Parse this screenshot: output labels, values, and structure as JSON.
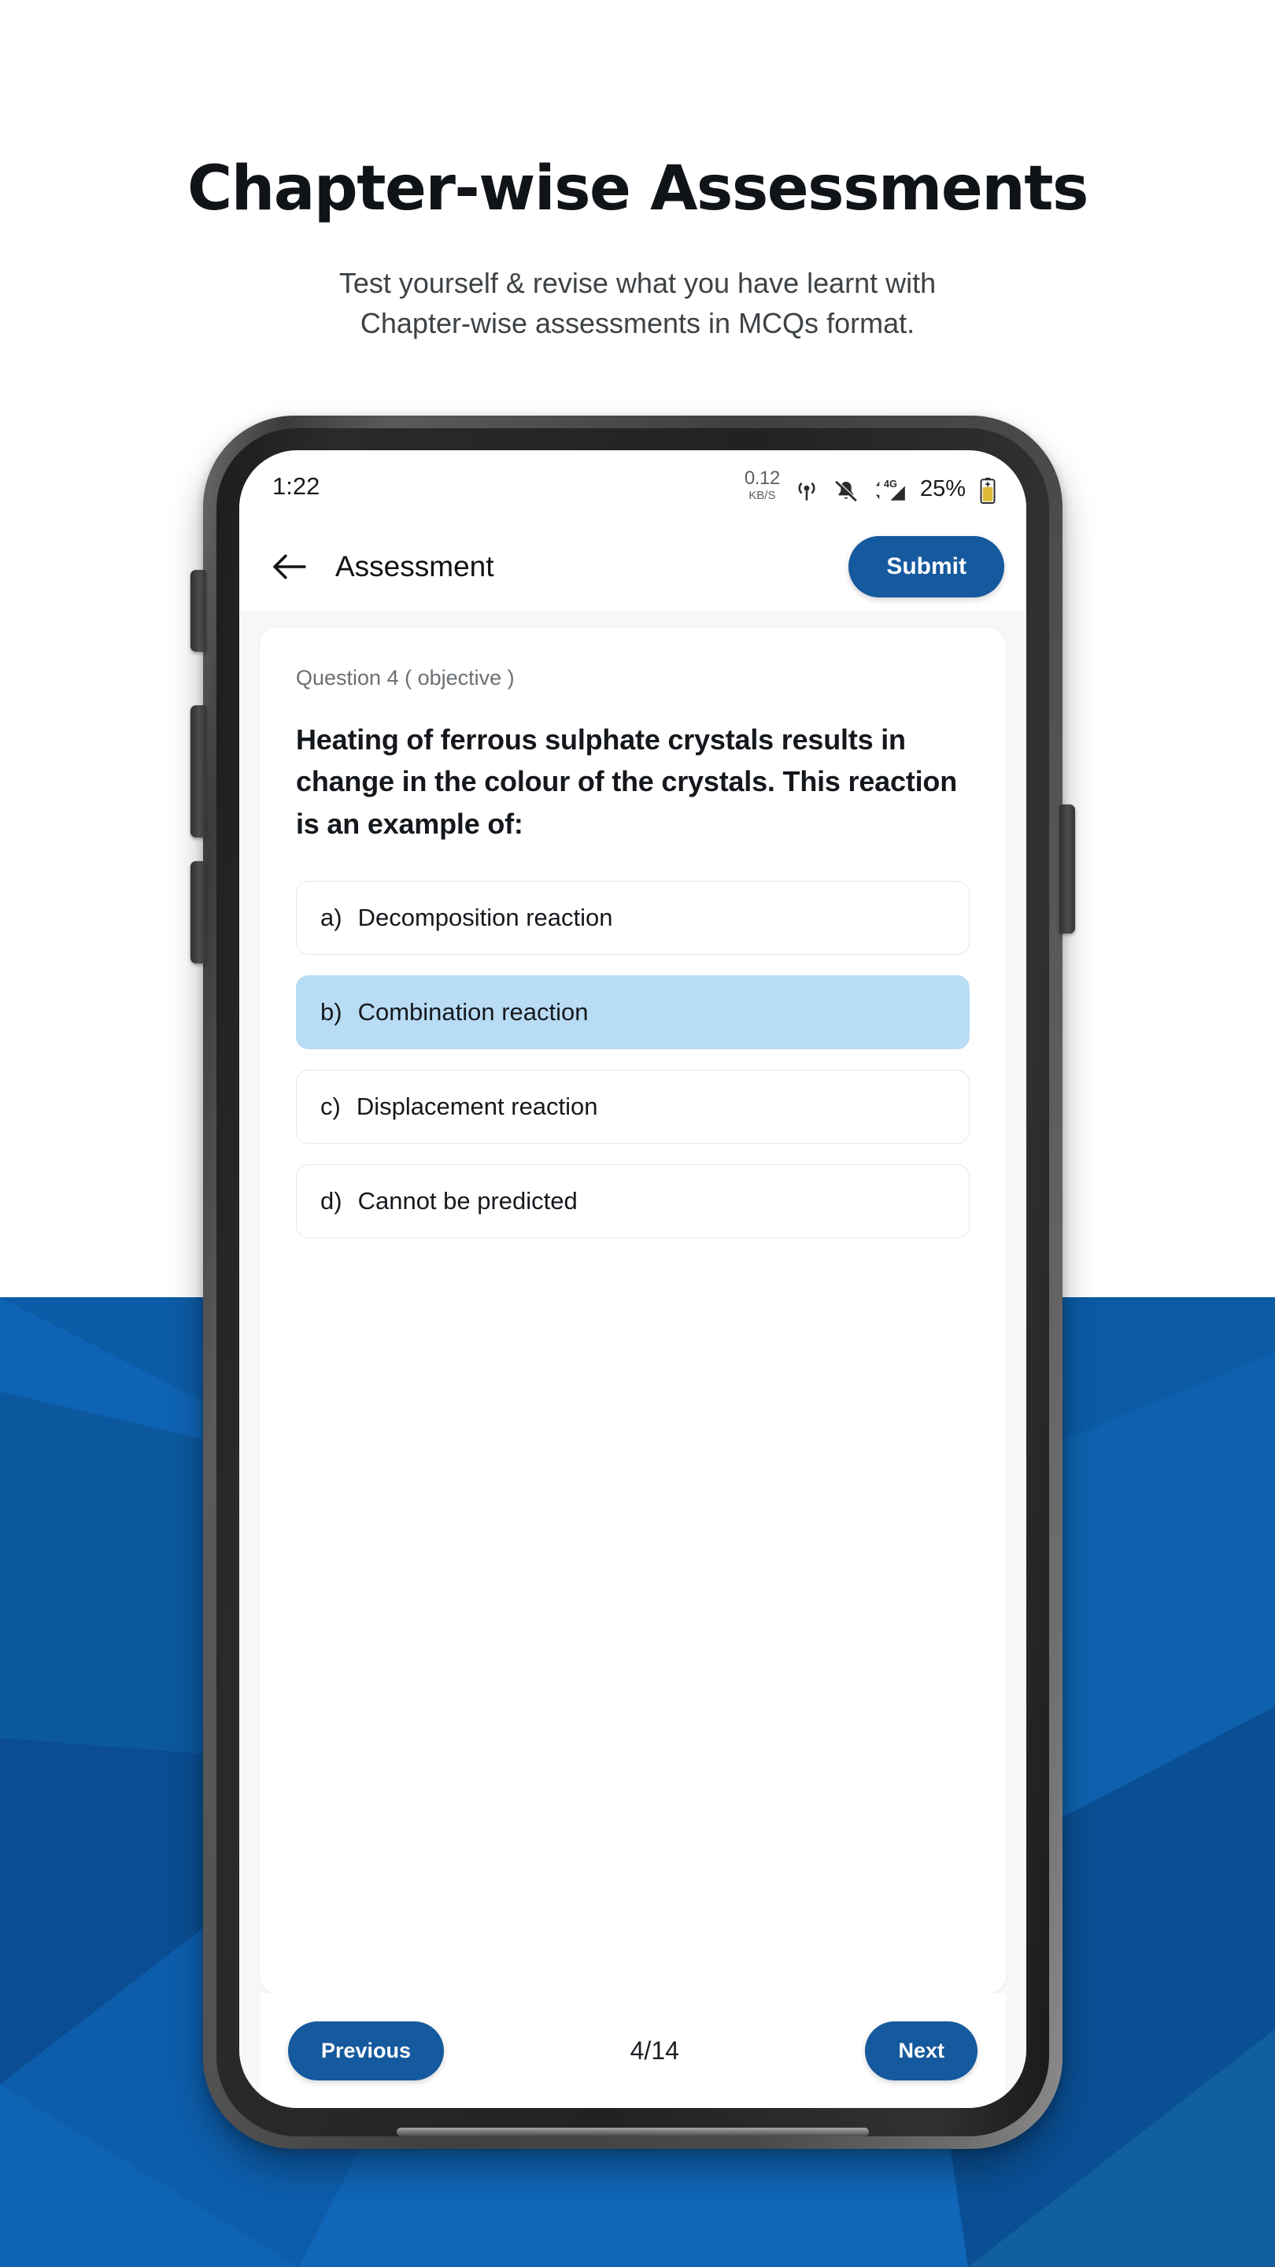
{
  "page": {
    "title": "Chapter-wise Assessments",
    "subtitle_line1": "Test yourself & revise what you have learnt with",
    "subtitle_line2": "Chapter-wise assessments in MCQs format.",
    "background_white": "#ffffff",
    "background_blue": "#0b5ead"
  },
  "phone": {
    "frame_color": "#454545",
    "bezel_color": "#222222"
  },
  "status_bar": {
    "time": "1:22",
    "net_speed_value": "0.12",
    "net_speed_unit": "KB/S",
    "icons": [
      "location-icon",
      "bell-muted-icon",
      "signal-4g-icon"
    ],
    "signal_label": "4G",
    "battery_percent": "25%"
  },
  "app_bar": {
    "back_icon": "arrow-left-icon",
    "title": "Assessment",
    "submit_label": "Submit",
    "accent_color": "#15599e"
  },
  "question": {
    "meta": "Question 4 ( objective )",
    "text": "Heating of ferrous sulphate crystals results in change in the colour of the crystals. This reaction is an example of:",
    "options": [
      {
        "key": "a)",
        "label": "Decomposition reaction",
        "selected": false
      },
      {
        "key": "b)",
        "label": "Combination reaction",
        "selected": true
      },
      {
        "key": "c)",
        "label": "Displacement reaction",
        "selected": false
      },
      {
        "key": "d)",
        "label": "Cannot be predicted",
        "selected": false
      }
    ],
    "selected_color": "#b9dcf5"
  },
  "bottom_nav": {
    "previous_label": "Previous",
    "page_indicator": "4/14",
    "next_label": "Next"
  }
}
